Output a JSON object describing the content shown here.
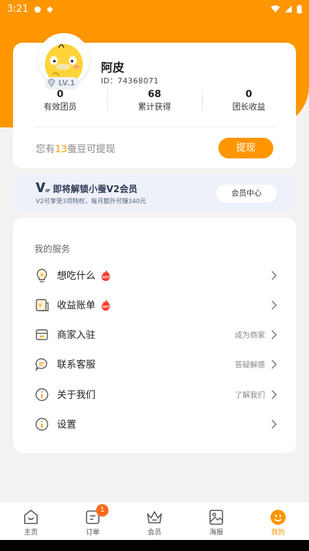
{
  "status_bar": {
    "time": "3:21"
  },
  "profile": {
    "nickname": "阿皮",
    "user_id": "ID：74368071",
    "level": "LV.1",
    "stats": [
      {
        "value": "0",
        "label": "有效团员"
      },
      {
        "value": "68",
        "label": "累计获得"
      },
      {
        "value": "0",
        "label": "团长收益"
      }
    ],
    "withdraw_prefix": "您有",
    "withdraw_amount": "13",
    "withdraw_suffix": "蚕豆可提现",
    "withdraw_button": "提现"
  },
  "vip": {
    "title": "即将解锁小蚕V2会员",
    "subtitle": "V2可享受3项特权，每月额外可赚340元",
    "button": "会员中心"
  },
  "services": {
    "title": "我的服务",
    "items": [
      {
        "label": "想吃什么",
        "icon": "bulb-icon",
        "hot": true,
        "hint": ""
      },
      {
        "label": "收益账单",
        "icon": "bill-icon",
        "hot": true,
        "hint": ""
      },
      {
        "label": "商家入驻",
        "icon": "store-icon",
        "hot": false,
        "hint": "成为商家"
      },
      {
        "label": "联系客服",
        "icon": "chat-icon",
        "hot": false,
        "hint": "答疑解惑"
      },
      {
        "label": "关于我们",
        "icon": "info-icon",
        "hot": false,
        "hint": "了解我们"
      },
      {
        "label": "设置",
        "icon": "info-icon",
        "hot": false,
        "hint": ""
      }
    ]
  },
  "tabbar": {
    "tabs": [
      {
        "label": "主页",
        "icon": "home-icon"
      },
      {
        "label": "订单",
        "icon": "order-icon",
        "badge": "1"
      },
      {
        "label": "会员",
        "icon": "crown-icon"
      },
      {
        "label": "海报",
        "icon": "poster-icon"
      },
      {
        "label": "我的",
        "icon": "profile-icon",
        "active": true
      }
    ]
  },
  "colors": {
    "accent": "#ff9600",
    "vip_bg": "#eef1fa"
  }
}
